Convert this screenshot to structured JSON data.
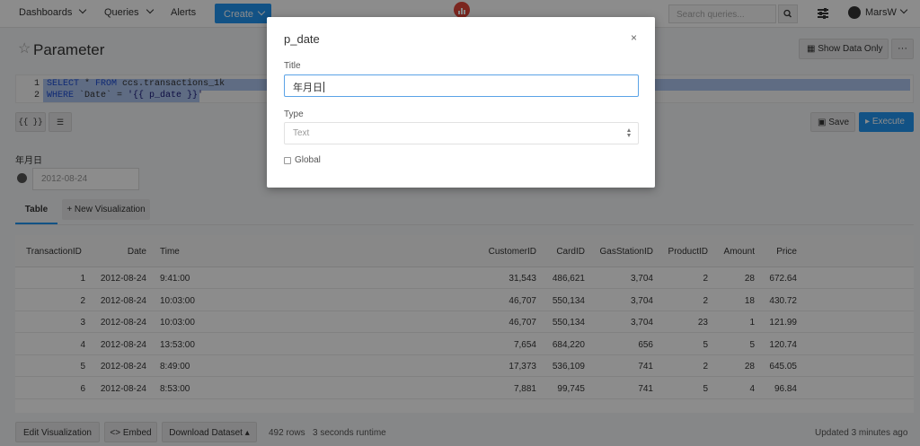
{
  "nav": {
    "dashboards": "Dashboards",
    "queries": "Queries",
    "alerts": "Alerts",
    "create": "Create",
    "search_placeholder": "Search queries...",
    "user": "MarsW"
  },
  "page": {
    "title": "Parameter",
    "show_data_only": "Show Data Only",
    "more": "···"
  },
  "editor": {
    "lines": [
      {
        "n": "1",
        "kw1": "SELECT",
        "mid1": " * ",
        "kw2": "FROM",
        "rest": " ccs.transactions_1k"
      },
      {
        "n": "2",
        "kw1": "WHERE",
        "mid1": " `Date` = ",
        "str": "'{{ p_date }}'"
      }
    ]
  },
  "toolbar": {
    "params_btn": "{{ }}",
    "save": "Save",
    "execute": "Execute"
  },
  "parameter": {
    "label": "年月日",
    "value": "2012-08-24"
  },
  "tabs": {
    "table": "Table",
    "new_vis": "+ New Visualization"
  },
  "table": {
    "headers": [
      "TransactionID",
      "Date",
      "Time",
      "CustomerID",
      "CardID",
      "GasStationID",
      "ProductID",
      "Amount",
      "Price"
    ],
    "rows": [
      [
        "1",
        "2012-08-24",
        "9:41:00",
        "31,543",
        "486,621",
        "3,704",
        "2",
        "28",
        "672.64"
      ],
      [
        "2",
        "2012-08-24",
        "10:03:00",
        "46,707",
        "550,134",
        "3,704",
        "2",
        "18",
        "430.72"
      ],
      [
        "3",
        "2012-08-24",
        "10:03:00",
        "46,707",
        "550,134",
        "3,704",
        "23",
        "1",
        "121.99"
      ],
      [
        "4",
        "2012-08-24",
        "13:53:00",
        "7,654",
        "684,220",
        "656",
        "5",
        "5",
        "120.74"
      ],
      [
        "5",
        "2012-08-24",
        "8:49:00",
        "17,373",
        "536,109",
        "741",
        "2",
        "28",
        "645.05"
      ],
      [
        "6",
        "2012-08-24",
        "8:53:00",
        "7,881",
        "99,745",
        "741",
        "5",
        "4",
        "96.84"
      ]
    ]
  },
  "footer": {
    "edit_vis": "Edit Visualization",
    "embed": "<> Embed",
    "download": "Download Dataset",
    "rows": "492 rows",
    "runtime": "3 seconds runtime",
    "updated": "Updated 3 minutes ago"
  },
  "modal": {
    "title": "p_date",
    "close": "×",
    "title_label": "Title",
    "title_value": "年月日",
    "type_label": "Type",
    "type_value": "Text",
    "global_label": "Global"
  },
  "colors": {
    "primary": "#2196f3",
    "logo": "#e0453a",
    "selection": "#aec5ee"
  }
}
